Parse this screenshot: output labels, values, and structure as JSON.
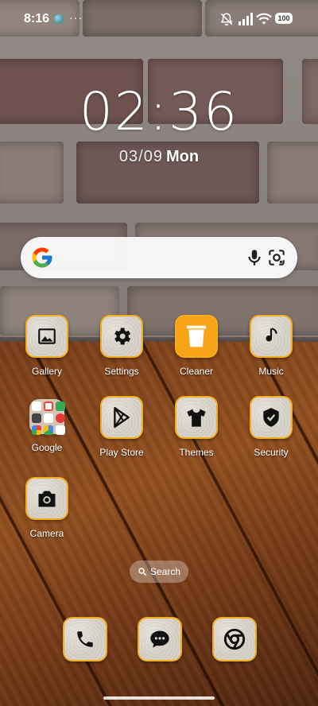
{
  "status_bar": {
    "time": "8:16",
    "more": "···",
    "battery": "100",
    "icons": [
      "status-dot-icon",
      "mute-icon",
      "signal-icon",
      "wifi-icon",
      "battery-icon"
    ]
  },
  "clock": {
    "time": "02:36",
    "date": "03/09",
    "weekday": "Mon"
  },
  "search_widget": {
    "icons": [
      "google-g-icon",
      "mic-icon",
      "lens-icon"
    ]
  },
  "apps": [
    {
      "label": "Gallery",
      "icon": "gallery-icon"
    },
    {
      "label": "Settings",
      "icon": "gear-icon"
    },
    {
      "label": "Cleaner",
      "icon": "trash-icon"
    },
    {
      "label": "Music",
      "icon": "music-note-icon"
    },
    {
      "label": "Google",
      "icon": "folder-icon"
    },
    {
      "label": "Play Store",
      "icon": "play-store-icon"
    },
    {
      "label": "Themes",
      "icon": "tshirt-icon"
    },
    {
      "label": "Security",
      "icon": "shield-icon"
    },
    {
      "label": "Camera",
      "icon": "camera-icon"
    }
  ],
  "search_pill": {
    "label": "Search"
  },
  "dock": [
    {
      "icon": "phone-icon"
    },
    {
      "icon": "message-icon"
    },
    {
      "icon": "chrome-icon"
    }
  ],
  "colors": {
    "tile_border": "#f2ad1c",
    "cleaner_bg": "#f6a316"
  }
}
